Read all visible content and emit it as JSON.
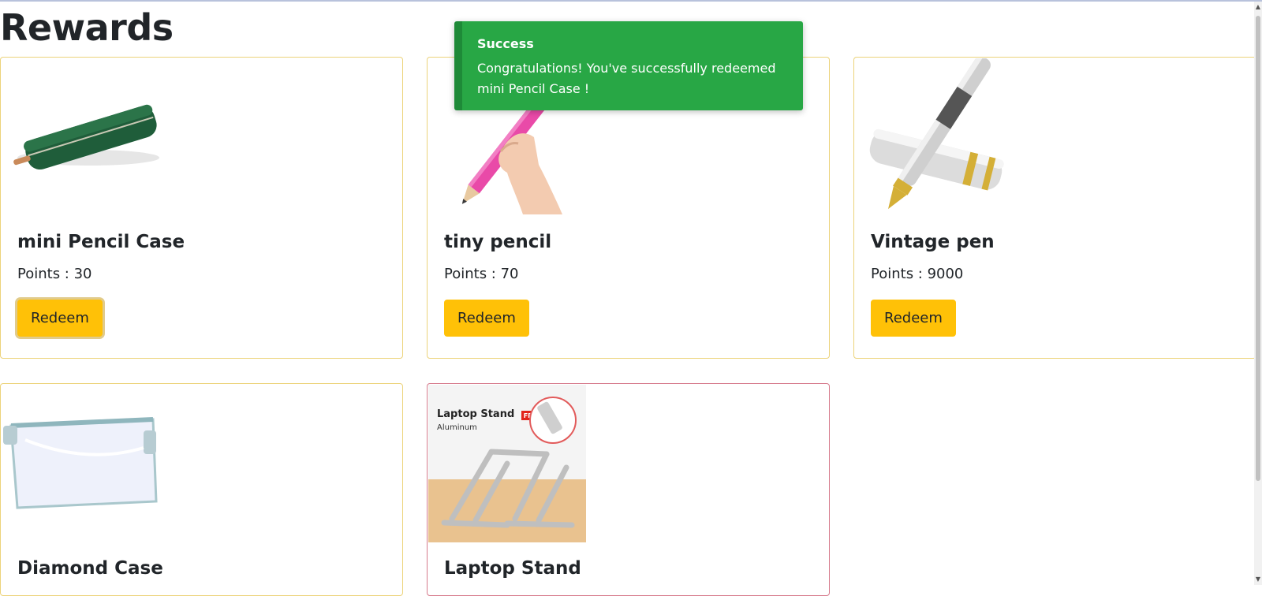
{
  "page": {
    "title": "Rewards"
  },
  "toast": {
    "title": "Success",
    "message": "Congratulations! You've successfully redeemed mini Pencil Case !",
    "color": "#28a745"
  },
  "rewards": [
    {
      "name": "mini Pencil Case",
      "points": "Points : 30",
      "button": "Redeem",
      "image_icon": "pencil-case-icon"
    },
    {
      "name": "tiny pencil",
      "points": "Points : 70",
      "button": "Redeem",
      "image_icon": "pencil-icon"
    },
    {
      "name": "Vintage pen",
      "points": "Points : 9000",
      "button": "Redeem",
      "image_icon": "fountain-pen-icon"
    },
    {
      "name": "Diamond Case",
      "image_icon": "clear-case-icon"
    },
    {
      "name": "Laptop Stand",
      "image_icon": "laptop-stand-icon",
      "image_caption": "Laptop Stand",
      "image_subcaption": "Aluminum",
      "image_badge": "FREE"
    }
  ],
  "colors": {
    "button": "#ffc107",
    "card_border": "#ecd37a",
    "card_border_alt": "#d67a8c"
  }
}
